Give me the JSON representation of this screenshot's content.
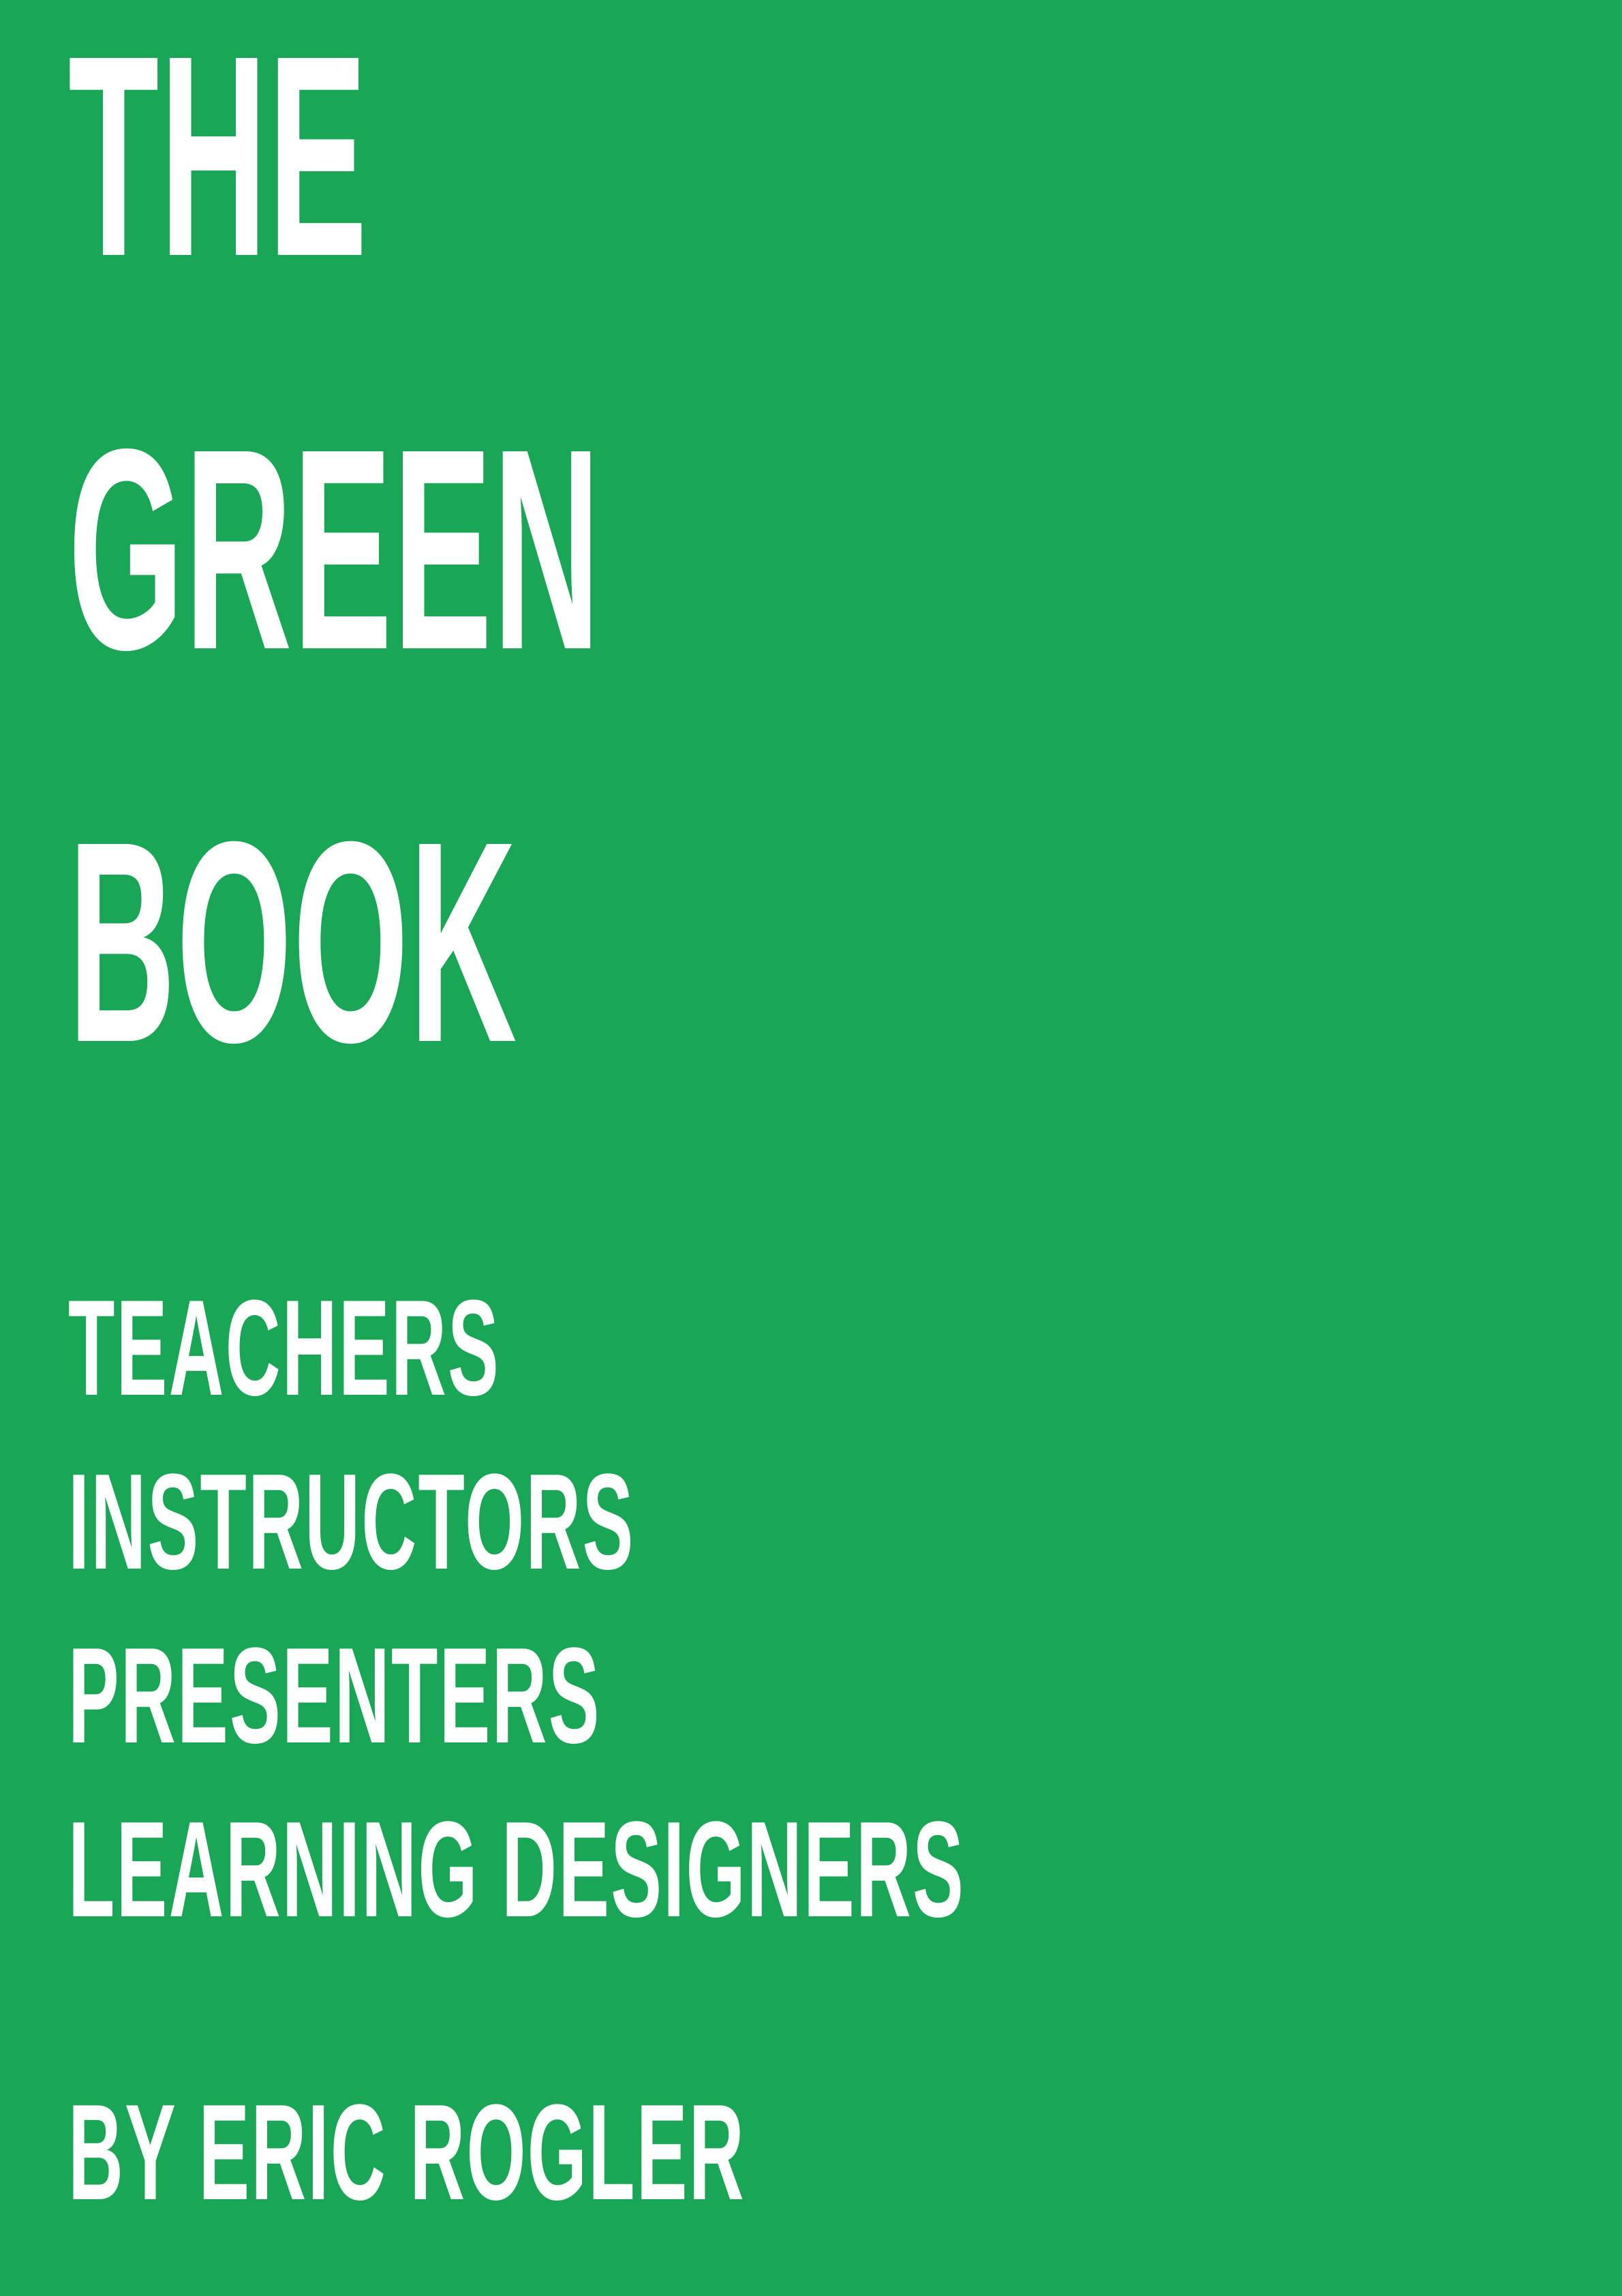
{
  "cover": {
    "background_color": "#1aa657",
    "text_color": "#ffffff",
    "title_lines": [
      "THE",
      "GREEN",
      "BOOK"
    ],
    "audience": [
      "TEACHERS",
      "INSTRUCTORS",
      "PRESENTERS",
      "LEARNING DESIGNERS"
    ],
    "byline": "BY ERIC ROGLER"
  }
}
